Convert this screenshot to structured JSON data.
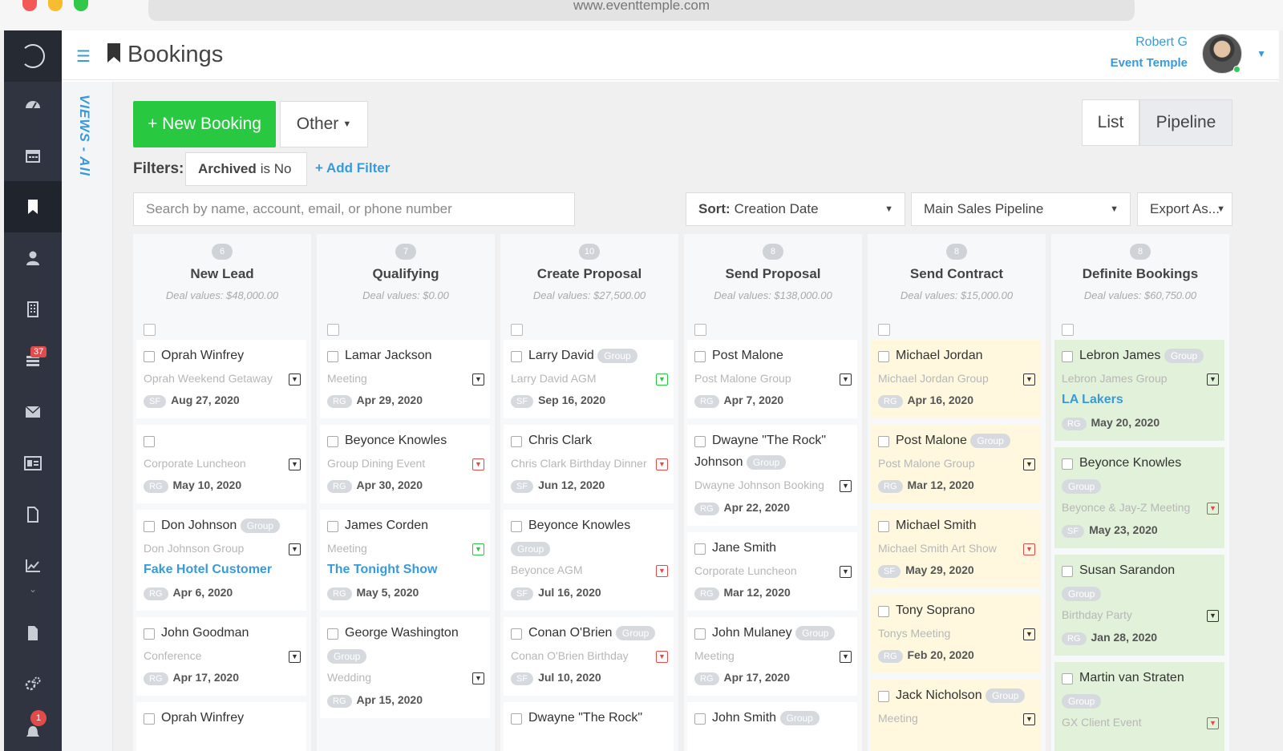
{
  "browser": {
    "url": "www.eventtemple.com"
  },
  "header": {
    "title": "Bookings",
    "user_name": "Robert G",
    "company": "Event Temple"
  },
  "sidebar": {
    "items": [
      {
        "icon": "dashboard-icon"
      },
      {
        "icon": "calendar-icon"
      },
      {
        "icon": "bookmark-icon",
        "active": true
      },
      {
        "icon": "user-icon"
      },
      {
        "icon": "building-icon"
      },
      {
        "icon": "tasks-icon",
        "badge": "37"
      },
      {
        "icon": "mail-icon"
      },
      {
        "icon": "id-card-icon"
      },
      {
        "icon": "document-icon"
      },
      {
        "icon": "chart-icon"
      },
      {
        "icon": "file-icon"
      },
      {
        "icon": "settings-icon"
      },
      {
        "icon": "notification-icon",
        "badge": "1"
      }
    ]
  },
  "views": {
    "label": "VIEWS - All"
  },
  "toolbar": {
    "new_booking": "+ New Booking",
    "other": "Other",
    "list": "List",
    "pipeline": "Pipeline"
  },
  "filters": {
    "label": "Filters:",
    "chip_field": "Archived",
    "chip_rest": "is No",
    "add_filter": "+ Add Filter"
  },
  "search": {
    "placeholder": "Search by name, account, email, or phone number"
  },
  "sort": {
    "label": "Sort:",
    "value": "Creation Date"
  },
  "pipeline_select": {
    "value": "Main Sales Pipeline"
  },
  "export": {
    "label": "Export As..."
  },
  "columns": [
    {
      "count": "6",
      "title": "New Lead",
      "deals": "Deal values: $48,000.00",
      "cards": [
        {
          "name": "Oprah Winfrey",
          "event": "Oprah Weekend Getaway",
          "initials": "SF",
          "date": "Aug 27, 2020",
          "task": "plain"
        },
        {
          "name": "",
          "event": "Corporate Luncheon",
          "initials": "RG",
          "date": "May 10, 2020",
          "task": "plain"
        },
        {
          "name": "Don Johnson",
          "group": "Group",
          "event": "Don Johnson Group",
          "account": "Fake Hotel Customer",
          "initials": "RG",
          "date": "Apr 6, 2020",
          "task": "plain"
        },
        {
          "name": "John Goodman",
          "event": "Conference",
          "initials": "RG",
          "date": "Apr 17, 2020",
          "task": "plain"
        },
        {
          "name": "Oprah Winfrey"
        }
      ]
    },
    {
      "count": "7",
      "title": "Qualifying",
      "deals": "Deal values: $0.00",
      "cards": [
        {
          "name": "Lamar Jackson",
          "event": "Meeting",
          "initials": "RG",
          "date": "Apr 29, 2020",
          "task": "plain"
        },
        {
          "name": "Beyonce Knowles",
          "event": "Group Dining Event",
          "initials": "RG",
          "date": "Apr 30, 2020",
          "task": "red"
        },
        {
          "name": "James Corden",
          "event": "Meeting",
          "account": "The Tonight Show",
          "initials": "RG",
          "date": "May 5, 2020",
          "task": "green"
        },
        {
          "name": "George Washington",
          "group": "Group",
          "event": "Wedding",
          "initials": "RG",
          "date": "Apr 15, 2020",
          "task": "plain"
        }
      ]
    },
    {
      "count": "10",
      "title": "Create Proposal",
      "deals": "Deal values: $27,500.00",
      "cards": [
        {
          "name": "Larry David",
          "group": "Group",
          "event": "Larry David AGM",
          "initials": "SF",
          "date": "Sep 16, 2020",
          "task": "green"
        },
        {
          "name": "Chris Clark",
          "event": "Chris Clark Birthday Dinner",
          "initials": "SF",
          "date": "Jun 12, 2020",
          "task": "red"
        },
        {
          "name": "Beyonce Knowles",
          "group": "Group",
          "event": "Beyonce AGM",
          "initials": "SF",
          "date": "Jul 16, 2020",
          "task": "red"
        },
        {
          "name": "Conan O'Brien",
          "group": "Group",
          "event": "Conan O'Brien Birthday",
          "initials": "SF",
          "date": "Jul 10, 2020",
          "task": "red"
        },
        {
          "name": "Dwayne \"The Rock\""
        }
      ]
    },
    {
      "count": "8",
      "title": "Send Proposal",
      "deals": "Deal values: $138,000.00",
      "cards": [
        {
          "name": "Post Malone",
          "event": "Post Malone Group",
          "initials": "RG",
          "date": "Apr 7, 2020",
          "task": "plain"
        },
        {
          "name": "Dwayne \"The Rock\"",
          "name2": "Johnson",
          "group": "Group",
          "event": "Dwayne Johnson Booking",
          "initials": "RG",
          "date": "Apr 22, 2020",
          "task": "plain"
        },
        {
          "name": "Jane Smith",
          "event": "Corporate Luncheon",
          "initials": "RG",
          "date": "Mar 12, 2020",
          "task": "plain"
        },
        {
          "name": "John Mulaney",
          "group": "Group",
          "event": "Meeting",
          "initials": "RG",
          "date": "Apr 17, 2020",
          "task": "plain"
        },
        {
          "name": "John Smith",
          "group": "Group"
        }
      ]
    },
    {
      "count": "8",
      "title": "Send Contract",
      "deals": "Deal values: $15,000.00",
      "cards": [
        {
          "name": "Michael Jordan",
          "event": "Michael Jordan Group",
          "initials": "RG",
          "date": "Apr 16, 2020",
          "task": "plain"
        },
        {
          "name": "Post Malone",
          "group": "Group",
          "event": "Post Malone Group",
          "initials": "RG",
          "date": "Mar 12, 2020",
          "task": "plain"
        },
        {
          "name": "Michael Smith",
          "event": "Michael Smith Art Show",
          "initials": "SF",
          "date": "May 29, 2020",
          "task": "red"
        },
        {
          "name": "Tony Soprano",
          "event": "Tonys Meeting",
          "initials": "RG",
          "date": "Feb 20, 2020",
          "task": "plain"
        },
        {
          "name": "Jack Nicholson",
          "group": "Group",
          "event": "Meeting",
          "task": "plain"
        }
      ]
    },
    {
      "count": "8",
      "title": "Definite Bookings",
      "deals": "Deal values: $60,750.00",
      "cards": [
        {
          "name": "Lebron James",
          "group": "Group",
          "event": "Lebron James Group",
          "account": "LA Lakers",
          "initials": "RG",
          "date": "May 20, 2020",
          "task": "plain"
        },
        {
          "name": "Beyonce Knowles",
          "group": "Group",
          "event": "Beyonce & Jay-Z Meeting",
          "initials": "SF",
          "date": "May 23, 2020",
          "task": "red"
        },
        {
          "name": "Susan Sarandon",
          "group": "Group",
          "event": "Birthday Party",
          "initials": "RG",
          "date": "Jan 28, 2020",
          "task": "plain"
        },
        {
          "name": "Martin van Straten",
          "group": "Group",
          "event": "GX Client Event",
          "task": "red"
        }
      ]
    }
  ],
  "colors": {
    "accent": "#3a9ad9",
    "new_booking": "#28c940",
    "sidebar": "#2f3440",
    "contract_card": "#fff8df",
    "definite_card": "#e2f1da"
  }
}
